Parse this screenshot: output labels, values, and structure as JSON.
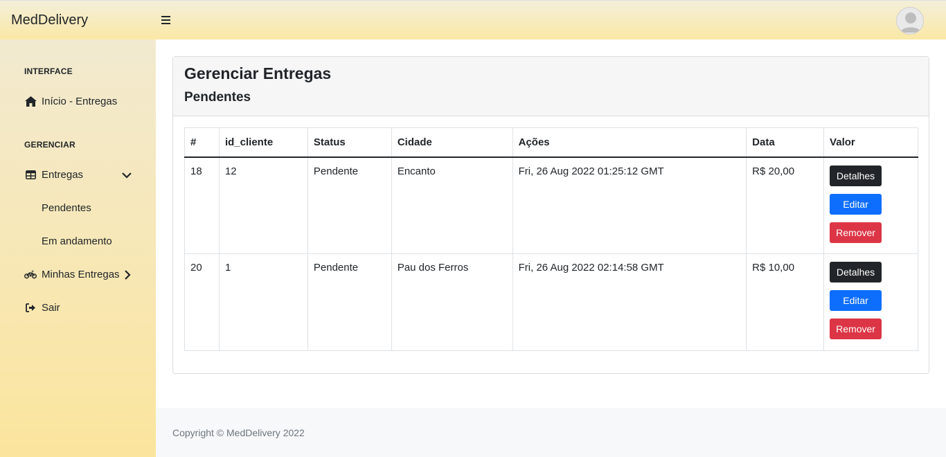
{
  "brand": "MedDelivery",
  "topbar": {
    "toggle_icon": "bars-icon",
    "avatar_icon": "user-avatar-icon"
  },
  "sidebar": {
    "heading_interface": "INTERFACE",
    "item_inicio": "Início - Entregas",
    "heading_gerenciar": "GERENCIAR",
    "item_entregas": "Entregas",
    "sub_pendentes": "Pendentes",
    "sub_andamento": "Em andamento",
    "item_minhas": "Minhas Entregas",
    "item_sair": "Sair"
  },
  "card": {
    "title": "Gerenciar Entregas",
    "subtitle": "Pendentes"
  },
  "table": {
    "headers": [
      "#",
      "id_cliente",
      "Status",
      "Cidade",
      "Ações",
      "Data",
      "Valor"
    ],
    "rows": [
      {
        "id": "18",
        "id_cliente": "12",
        "status": "Pendente",
        "cidade": "Encanto",
        "acoes": "Fri, 26 Aug 2022 01:25:12 GMT",
        "data": "R$ 20,00"
      },
      {
        "id": "20",
        "id_cliente": "1",
        "status": "Pendente",
        "cidade": "Pau dos Ferros",
        "acoes": "Fri, 26 Aug 2022 02:14:58 GMT",
        "data": "R$ 10,00"
      }
    ],
    "btn_detalhes": "Detalhes",
    "btn_editar": "Editar",
    "btn_remover": "Remover"
  },
  "footer": {
    "copyright": "Copyright © MedDelivery 2022"
  },
  "colors": {
    "primary": "#0d6efd",
    "danger": "#dc3545",
    "dark": "#212529",
    "sidebar": "#fbe59d"
  }
}
